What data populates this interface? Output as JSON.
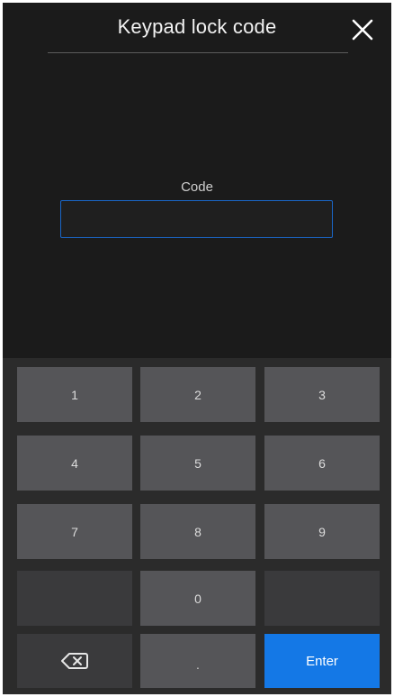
{
  "header": {
    "title": "Keypad lock code",
    "close_icon": "close-icon"
  },
  "form": {
    "code_label": "Code",
    "code_value": ""
  },
  "keypad": {
    "keys": [
      "1",
      "2",
      "3",
      "4",
      "5",
      "6",
      "7",
      "8",
      "9",
      "",
      "0",
      "",
      "backspace-icon",
      ".",
      "Enter"
    ]
  },
  "colors": {
    "background": "#1b1b1b",
    "key": "#555558",
    "key_dim": "#3a3a3c",
    "accent": "#1478e6",
    "input_border": "#1a66c7"
  }
}
